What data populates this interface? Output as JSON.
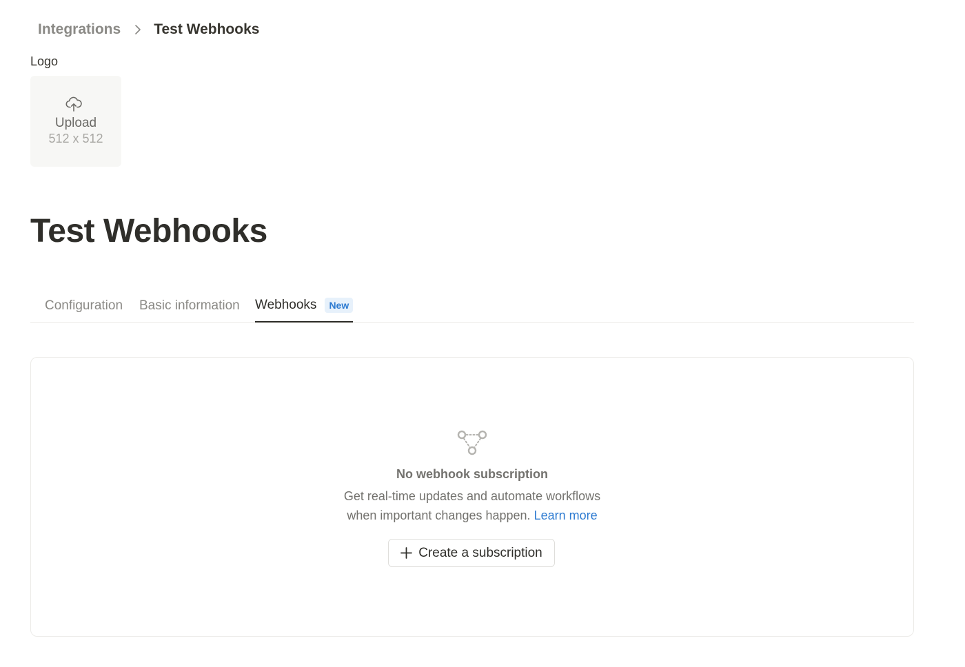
{
  "breadcrumb": {
    "parent": "Integrations",
    "current": "Test Webhooks"
  },
  "logo": {
    "label": "Logo",
    "upload_label": "Upload",
    "size_hint": "512 x 512",
    "icon": "cloud-upload-icon"
  },
  "page": {
    "title": "Test Webhooks"
  },
  "tabs": [
    {
      "label": "Configuration",
      "active": false
    },
    {
      "label": "Basic information",
      "active": false
    },
    {
      "label": "Webhooks",
      "active": true,
      "badge": "New"
    }
  ],
  "empty_state": {
    "icon": "webhook-icon",
    "title": "No webhook subscription",
    "description_line1": "Get real-time updates and automate workflows",
    "description_line2": "when important changes happen.",
    "link_label": "Learn more",
    "button_label": "Create a subscription",
    "button_icon": "plus-icon"
  },
  "colors": {
    "link": "#2e7bd1",
    "badge_bg": "#e7f1fb",
    "text_primary": "#2f2e2a",
    "text_muted": "#8a8985"
  }
}
